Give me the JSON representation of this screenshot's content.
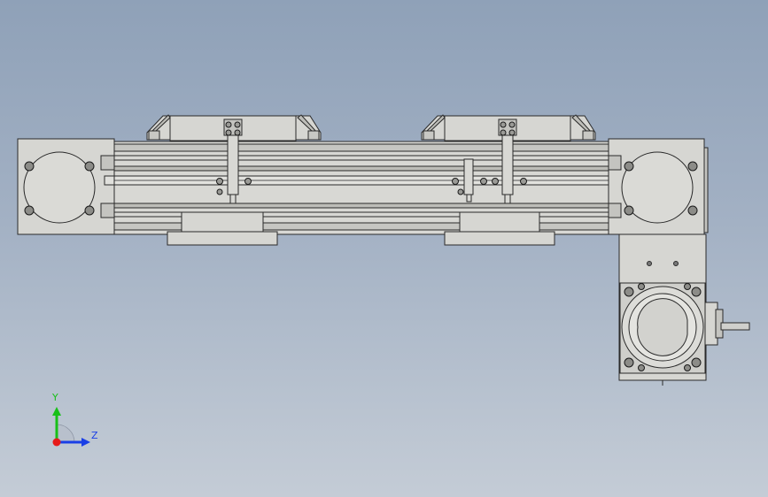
{
  "viewport": {
    "background_top": "#8fa1b8",
    "background_bottom": "#c4ccd6",
    "part_fill": "#d6d6d2",
    "part_stroke": "#2a2a2a"
  },
  "triad": {
    "y_label": "Y",
    "z_label": "Z",
    "y_color": "#18c018",
    "z_color": "#1a3fe6",
    "x_color": "#e61a1a"
  }
}
